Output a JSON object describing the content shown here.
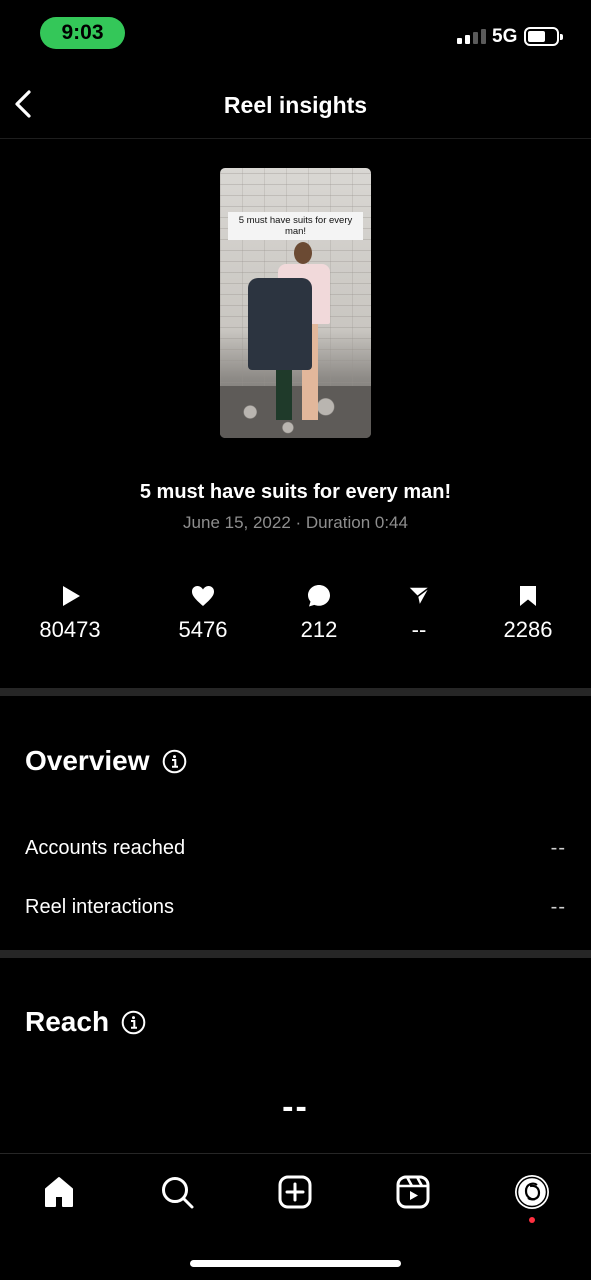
{
  "status_bar": {
    "time": "9:03",
    "network": "5G"
  },
  "header": {
    "title": "Reel insights",
    "back_icon": "chevron-left-icon"
  },
  "reel": {
    "thumbnail_caption": "5 must have suits for every man!",
    "title": "5 must have suits for every man!",
    "meta": "June 15, 2022 · Duration 0:44"
  },
  "stats": {
    "plays": "80473",
    "likes": "5476",
    "comments": "212",
    "shares": "--",
    "saves": "2286"
  },
  "overview": {
    "title": "Overview",
    "rows": [
      {
        "label": "Accounts reached",
        "value": "--"
      },
      {
        "label": "Reel interactions",
        "value": "--"
      }
    ]
  },
  "reach": {
    "title": "Reach",
    "value": "--"
  },
  "nav": [
    "home-icon",
    "search-icon",
    "create-icon",
    "reels-icon",
    "profile-icon"
  ],
  "colors": {
    "time_pill": "#34c759",
    "divider": "#262626",
    "meta_text": "#8e8e8e",
    "notification_dot": "#ff3040"
  }
}
